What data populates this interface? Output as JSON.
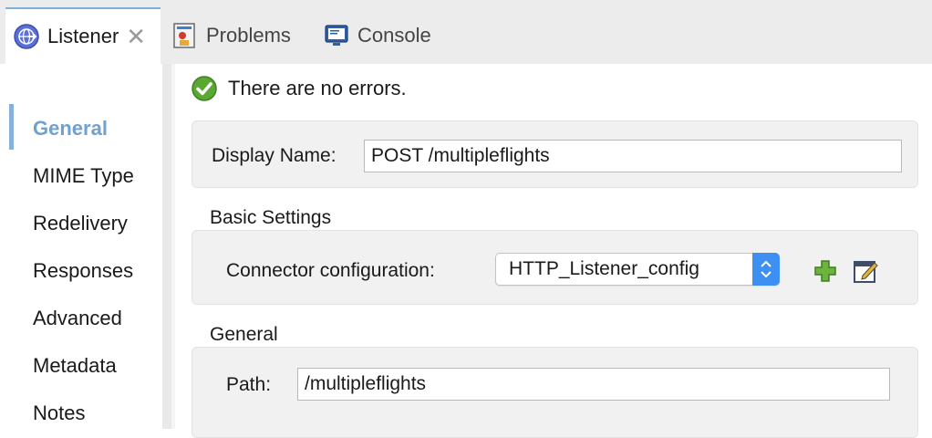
{
  "tabs": [
    {
      "label": "Listener",
      "close": "✕"
    },
    {
      "label": "Problems"
    },
    {
      "label": "Console"
    }
  ],
  "sidebar": {
    "items": [
      {
        "label": "General",
        "active": true
      },
      {
        "label": "MIME Type"
      },
      {
        "label": "Redelivery"
      },
      {
        "label": "Responses"
      },
      {
        "label": "Advanced"
      },
      {
        "label": "Metadata"
      },
      {
        "label": "Notes"
      }
    ]
  },
  "status": {
    "message": "There are no errors.",
    "icon": "check-circle-icon"
  },
  "display_name": {
    "label": "Display Name:",
    "value": "POST /multipleflights"
  },
  "basic_settings": {
    "title": "Basic Settings",
    "connector_label": "Connector configuration:",
    "connector_value": "HTTP_Listener_config",
    "add_icon": "plus-icon",
    "edit_icon": "edit-icon"
  },
  "general": {
    "title": "General",
    "path_label": "Path:",
    "path_value": "/multipleflights"
  },
  "colors": {
    "accent": "#6fa2cf",
    "select_button": "#3d8ff2",
    "ok_green": "#5aa833",
    "add_green": "#6db33f"
  }
}
